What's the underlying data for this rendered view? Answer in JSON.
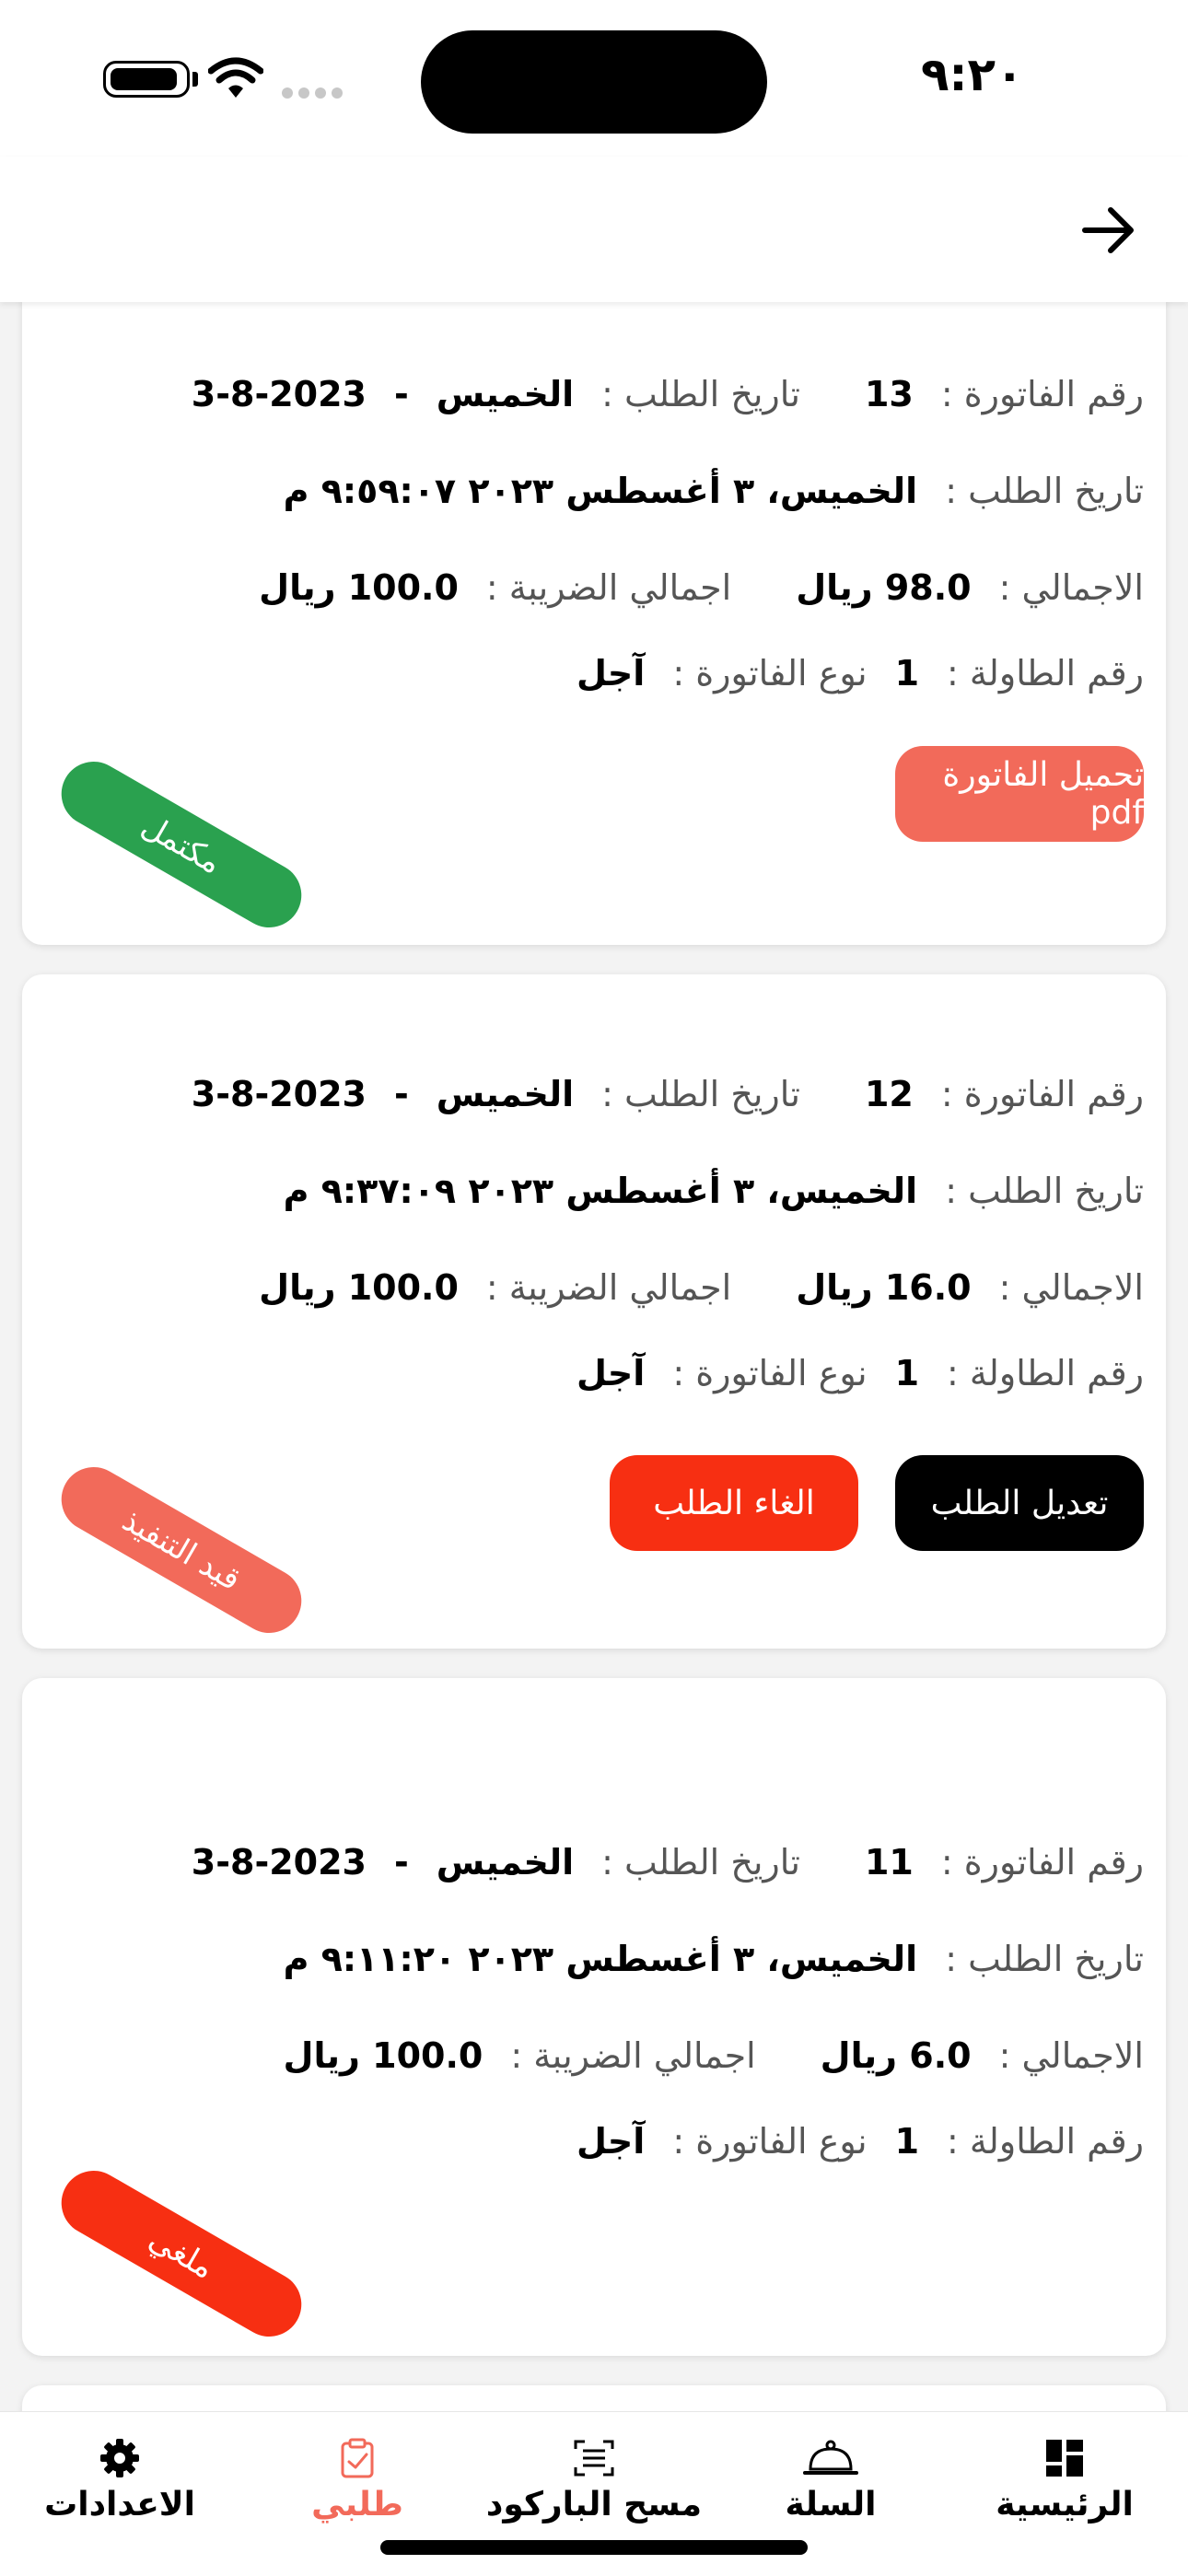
{
  "status": {
    "time": "٩:٢٠"
  },
  "orders": [
    {
      "invoice_label": "رقم الفاتورة :",
      "invoice_no": "13",
      "order_date_label": "تاريخ الطلب :",
      "weekday": "الخميس",
      "dash": "-",
      "date": "3-8-2023",
      "datetime_label": "تاريخ الطلب :",
      "datetime": "الخميس، ٣ أغسطس ٢٠٢٣  ٩:٥٩:٠٧ م",
      "total_label": "الاجمالي :",
      "total": "98.0 ريال",
      "tax_total_label": "اجمالي الضريبة :",
      "tax_total": "100.0 ريال",
      "table_label": "رقم الطاولة :",
      "table_no": "1",
      "invoice_type_label": "نوع الفاتورة :",
      "invoice_type": "آجل",
      "download_button": "تحميل الفاتورة pdf",
      "status": "مكتمل"
    },
    {
      "invoice_label": "رقم الفاتورة :",
      "invoice_no": "12",
      "order_date_label": "تاريخ الطلب :",
      "weekday": "الخميس",
      "dash": "-",
      "date": "3-8-2023",
      "datetime_label": "تاريخ الطلب :",
      "datetime": "الخميس، ٣ أغسطس ٢٠٢٣  ٩:٣٧:٠٩ م",
      "total_label": "الاجمالي :",
      "total": "16.0 ريال",
      "tax_total_label": "اجمالي الضريبة :",
      "tax_total": "100.0 ريال",
      "table_label": "رقم الطاولة :",
      "table_no": "1",
      "invoice_type_label": "نوع الفاتورة :",
      "invoice_type": "آجل",
      "edit_button": "تعديل الطلب",
      "cancel_button": "الغاء الطلب",
      "status": "قيد التنفيذ"
    },
    {
      "invoice_label": "رقم الفاتورة :",
      "invoice_no": "11",
      "order_date_label": "تاريخ الطلب :",
      "weekday": "الخميس",
      "dash": "-",
      "date": "3-8-2023",
      "datetime_label": "تاريخ الطلب :",
      "datetime": "الخميس، ٣ أغسطس ٢٠٢٣  ٩:١١:٢٠ م",
      "total_label": "الاجمالي :",
      "total": "6.0 ريال",
      "tax_total_label": "اجمالي الضريبة :",
      "tax_total": "100.0 ريال",
      "table_label": "رقم الطاولة :",
      "table_no": "1",
      "invoice_type_label": "نوع الفاتورة :",
      "invoice_type": "آجل",
      "status": "ملغي"
    }
  ],
  "nav": [
    {
      "label": "الرئيسية",
      "icon": "dashboard-icon"
    },
    {
      "label": "السلة",
      "icon": "cloche-icon"
    },
    {
      "label": "مسح الباركود",
      "icon": "barcode-scan-icon"
    },
    {
      "label": "طلبي",
      "icon": "clipboard-check-icon",
      "active": true
    },
    {
      "label": "الاعدادات",
      "icon": "gear-icon"
    }
  ],
  "colors": {
    "accent": "#f26a5a",
    "completed": "#2aa14f",
    "in_progress": "#f26a5a",
    "cancelled": "#f72f12",
    "cancel_button": "#f72f12",
    "edit_button": "#000000"
  }
}
